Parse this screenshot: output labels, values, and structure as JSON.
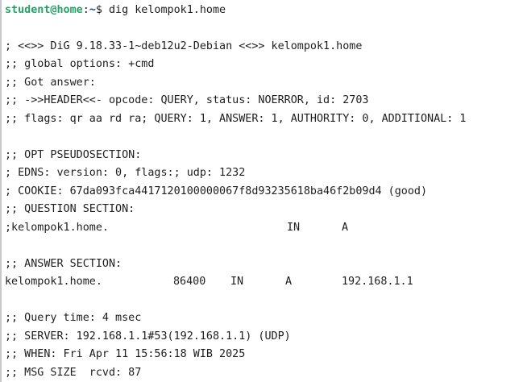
{
  "theme": {
    "background": "#ffffff",
    "text": "#1e1e1e",
    "prompt_user_color": "#26a269",
    "prompt_path_color": "#12488b"
  },
  "prompt": {
    "user_host": "student@home",
    "separator": ":",
    "path": "~",
    "symbol": "$ ",
    "command": "dig kelompok1.home"
  },
  "output": {
    "banner": "; <<>> DiG 9.18.33-1~deb12u2-Debian <<>> kelompok1.home",
    "global_options": ";; global options: +cmd",
    "got_answer": ";; Got answer:",
    "header": ";; ->>HEADER<<- opcode: QUERY, status: NOERROR, id: 2703",
    "flags": ";; flags: qr aa rd ra; QUERY: 1, ANSWER: 1, AUTHORITY: 0, ADDITIONAL: 1",
    "opt_section": ";; OPT PSEUDOSECTION:",
    "edns": "; EDNS: version: 0, flags:; udp: 1232",
    "cookie": "; COOKIE: 67da093fca4417120100000067f8d93235618ba46f2b09d4 (good)",
    "question_section": ";; QUESTION SECTION:",
    "question": {
      "name": ";kelompok1.home.",
      "class": "IN",
      "type": "A"
    },
    "answer_section": ";; ANSWER SECTION:",
    "answer": {
      "name": "kelompok1.home.",
      "ttl": "86400",
      "class": "IN",
      "type": "A",
      "address": "192.168.1.1"
    },
    "query_time": ";; Query time: 4 msec",
    "server": ";; SERVER: 192.168.1.1#53(192.168.1.1) (UDP)",
    "when": ";; WHEN: Fri Apr 11 15:56:18 WIB 2025",
    "msg_size": ";; MSG SIZE  rcvd: 87"
  }
}
